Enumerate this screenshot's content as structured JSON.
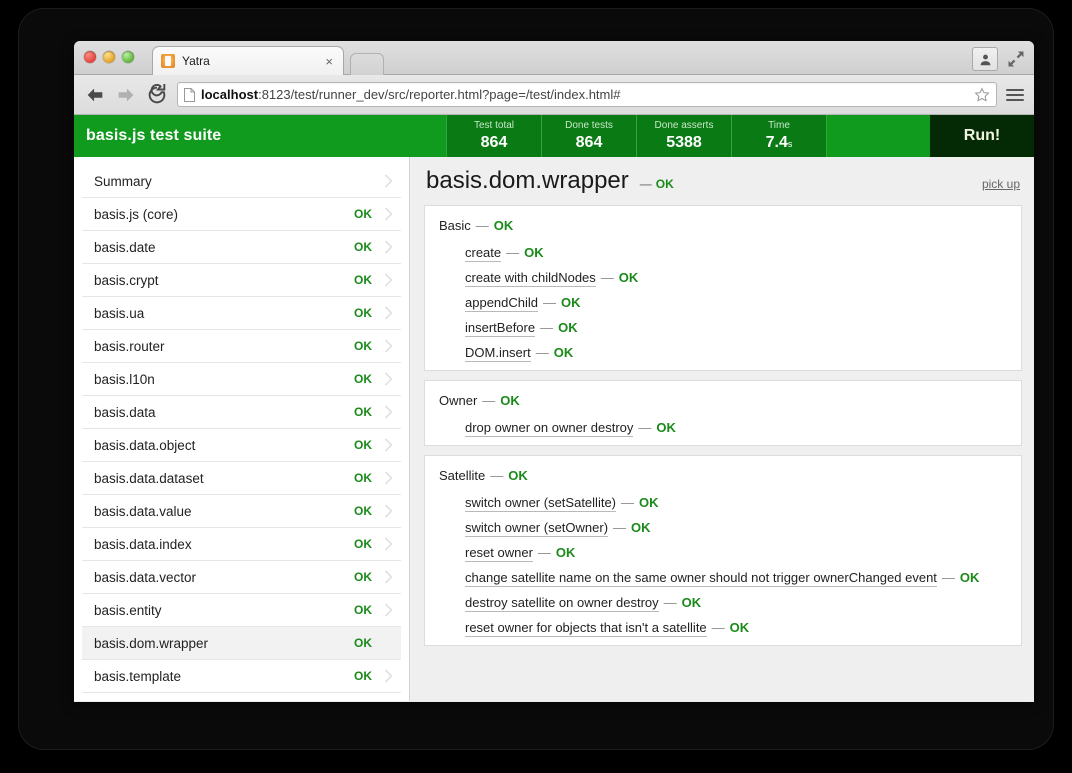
{
  "browser": {
    "tab_title": "Yatra",
    "tab_close_label": "×",
    "url_host": "localhost",
    "url_rest": ":8123/test/runner_dev/src/reporter.html?page=/test/index.html#",
    "icons": {
      "back": "back-arrow-icon",
      "forward": "forward-arrow-icon",
      "reload": "reload-icon",
      "page": "page-icon",
      "star": "star-icon",
      "menu": "hamburger-menu-icon",
      "profile": "profile-icon",
      "fullscreen": "fullscreen-icon",
      "favicon": "yatra-favicon"
    }
  },
  "app": {
    "brand": "basis.js test suite",
    "accent_green": "#119b1e",
    "stat_green": "#0a7a14",
    "ok_green": "#1a8a1a",
    "run_label": "Run!",
    "stats": [
      {
        "label": "Test total",
        "value": "864",
        "unit": ""
      },
      {
        "label": "Done tests",
        "value": "864",
        "unit": ""
      },
      {
        "label": "Done asserts",
        "value": "5388",
        "unit": ""
      },
      {
        "label": "Time",
        "value": "7.4",
        "unit": "s"
      }
    ]
  },
  "sidebar": {
    "ok_label": "OK",
    "items": [
      {
        "label": "Summary",
        "status": "",
        "selected": false
      },
      {
        "label": "basis.js (core)",
        "status": "OK",
        "selected": false
      },
      {
        "label": "basis.date",
        "status": "OK",
        "selected": false
      },
      {
        "label": "basis.crypt",
        "status": "OK",
        "selected": false
      },
      {
        "label": "basis.ua",
        "status": "OK",
        "selected": false
      },
      {
        "label": "basis.router",
        "status": "OK",
        "selected": false
      },
      {
        "label": "basis.l10n",
        "status": "OK",
        "selected": false
      },
      {
        "label": "basis.data",
        "status": "OK",
        "selected": false
      },
      {
        "label": "basis.data.object",
        "status": "OK",
        "selected": false
      },
      {
        "label": "basis.data.dataset",
        "status": "OK",
        "selected": false
      },
      {
        "label": "basis.data.value",
        "status": "OK",
        "selected": false
      },
      {
        "label": "basis.data.index",
        "status": "OK",
        "selected": false
      },
      {
        "label": "basis.data.vector",
        "status": "OK",
        "selected": false
      },
      {
        "label": "basis.entity",
        "status": "OK",
        "selected": false
      },
      {
        "label": "basis.dom.wrapper",
        "status": "OK",
        "selected": true
      },
      {
        "label": "basis.template",
        "status": "OK",
        "selected": false
      }
    ]
  },
  "main": {
    "title": "basis.dom.wrapper",
    "title_status": "OK",
    "dash": "—",
    "pick_up_label": "pick up",
    "panels": [
      {
        "suite": "Basic",
        "status": "OK",
        "cases": [
          {
            "name": "create",
            "status": "OK"
          },
          {
            "name": "create with childNodes",
            "status": "OK"
          },
          {
            "name": "appendChild",
            "status": "OK"
          },
          {
            "name": "insertBefore",
            "status": "OK"
          },
          {
            "name": "DOM.insert",
            "status": "OK"
          }
        ]
      },
      {
        "suite": "Owner",
        "status": "OK",
        "cases": [
          {
            "name": "drop owner on owner destroy",
            "status": "OK"
          }
        ]
      },
      {
        "suite": "Satellite",
        "status": "OK",
        "cases": [
          {
            "name": "switch owner (setSatellite)",
            "status": "OK"
          },
          {
            "name": "switch owner (setOwner)",
            "status": "OK"
          },
          {
            "name": "reset owner",
            "status": "OK"
          },
          {
            "name": "change satellite name on the same owner should not trigger ownerChanged event",
            "status": "OK"
          },
          {
            "name": "destroy satellite on owner destroy",
            "status": "OK"
          },
          {
            "name": "reset owner for objects that isn't a satellite",
            "status": "OK"
          }
        ]
      }
    ]
  }
}
